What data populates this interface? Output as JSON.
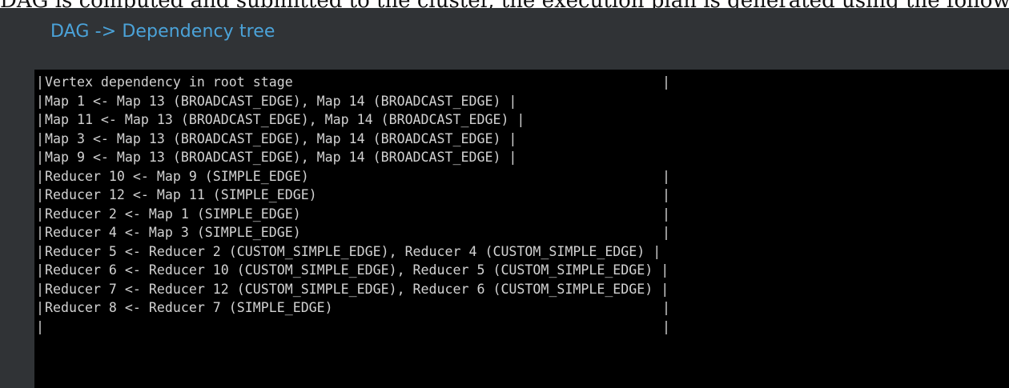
{
  "page": {
    "header_fragment": "DAG is computed and submitted to the cluster, the execution plan is generated using the following diagram"
  },
  "panel": {
    "title": "DAG -> Dependency tree"
  },
  "terminal": {
    "left_border": "|",
    "lines": [
      {
        "text": "Vertex dependency in root stage",
        "right_border": "|"
      },
      {
        "text": "Map 1 <- Map 13 (BROADCAST_EDGE), Map 14 (BROADCAST_EDGE) |",
        "right_border": ""
      },
      {
        "text": "Map 11 <- Map 13 (BROADCAST_EDGE), Map 14 (BROADCAST_EDGE) |",
        "right_border": ""
      },
      {
        "text": "Map 3 <- Map 13 (BROADCAST_EDGE), Map 14 (BROADCAST_EDGE) |",
        "right_border": ""
      },
      {
        "text": "Map 9 <- Map 13 (BROADCAST_EDGE), Map 14 (BROADCAST_EDGE) |",
        "right_border": ""
      },
      {
        "text": "Reducer 10 <- Map 9 (SIMPLE_EDGE)",
        "right_border": "|"
      },
      {
        "text": "Reducer 12 <- Map 11 (SIMPLE_EDGE)",
        "right_border": "|"
      },
      {
        "text": "Reducer 2 <- Map 1 (SIMPLE_EDGE)",
        "right_border": "|"
      },
      {
        "text": "Reducer 4 <- Map 3 (SIMPLE_EDGE)",
        "right_border": "|"
      },
      {
        "text": "Reducer 5 <- Reducer 2 (CUSTOM_SIMPLE_EDGE), Reducer 4 (CUSTOM_SIMPLE_EDGE) |",
        "right_border": ""
      },
      {
        "text": "Reducer 6 <- Reducer 10 (CUSTOM_SIMPLE_EDGE), Reducer 5 (CUSTOM_SIMPLE_EDGE) |",
        "right_border": ""
      },
      {
        "text": "Reducer 7 <- Reducer 12 (CUSTOM_SIMPLE_EDGE), Reducer 6 (CUSTOM_SIMPLE_EDGE) |",
        "right_border": ""
      },
      {
        "text": "Reducer 8 <- Reducer 7 (SIMPLE_EDGE)",
        "right_border": "|"
      },
      {
        "text": "",
        "right_border": "|"
      }
    ]
  }
}
